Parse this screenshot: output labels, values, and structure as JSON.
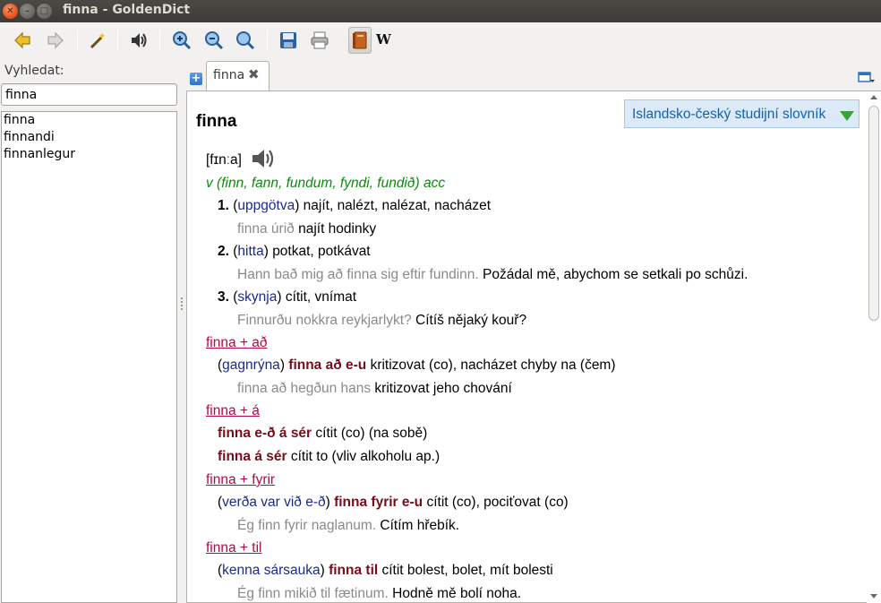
{
  "window": {
    "title": "finna - GoldenDict"
  },
  "toolbar": {
    "icons": [
      "back-icon",
      "forward-icon",
      "scan-popup-icon",
      "pronounce-icon",
      "zoom-in-icon",
      "zoom-out-icon",
      "zoom-reset-icon",
      "save-icon",
      "print-icon",
      "dictionary-bar-icon"
    ],
    "wiki_label": "W"
  },
  "search": {
    "label": "Vyhledat:",
    "value": "finna"
  },
  "word_list": [
    "finna",
    "finnandi",
    "finnanlegur"
  ],
  "tab": {
    "label": "finna",
    "close": "✖",
    "add": "+"
  },
  "article": {
    "headword": "finna",
    "dictionary": "Islandsko-český studijní slovník",
    "pronunciation": "[fɪnːa]",
    "grammar": "v (finn, fann, fundum, fyndi, fundið) acc",
    "senses": [
      {
        "num": "1.",
        "syn": "uppgötva",
        "def": "najít, nalézt, nalézat, nacházet",
        "ex_is": "finna úrið",
        "ex_cs": "najít hodinky"
      },
      {
        "num": "2.",
        "syn": "hitta",
        "def": "potkat, potkávat",
        "ex_is": "Hann bað mig að finna sig eftir fundinn.",
        "ex_cs": "Požádal mě, abychom se setkali po schůzi."
      },
      {
        "num": "3.",
        "syn": "skynja",
        "def": "cítit, vnímat",
        "ex_is": "Finnurðu nokkra reykjarlykt?",
        "ex_cs": "Cítíš nějaký kouř?"
      }
    ],
    "phrases": [
      {
        "link": "finna + að",
        "syn": "gagnrýna",
        "phrase": "finna að e-u",
        "def": "kritizovat (co), nacházet chyby na (čem)",
        "ex_is": "finna að hegðun hans",
        "ex_cs": "kritizovat jeho chování"
      },
      {
        "link": "finna + á",
        "p1": "finna e-ð á sér",
        "d1": "cítit (co) (na sobě)",
        "p2": "finna á sér",
        "d2": "cítit to (vliv alkoholu ap.)"
      },
      {
        "link": "finna + fyrir",
        "syn": "verða var við e-ð",
        "phrase": "finna fyrir e-u",
        "def": "cítit (co), pociťovat (co)",
        "ex_is": "Ég finn fyrir naglanum.",
        "ex_cs": "Cítím hřebík."
      },
      {
        "link": "finna + til",
        "syn": "kenna sársauka",
        "phrase": "finna til",
        "def": "cítit bolest, bolet, mít bolesti",
        "ex_is": "Ég finn mikið til fætinum.",
        "ex_cs": "Hodně mě bolí noha."
      }
    ]
  },
  "colors": {
    "link": "#b30c3c",
    "phrase": "#7a0c1a",
    "synonym": "#1a2a8a",
    "grammar": "#0c8a0c",
    "example": "#8a8a8a"
  }
}
